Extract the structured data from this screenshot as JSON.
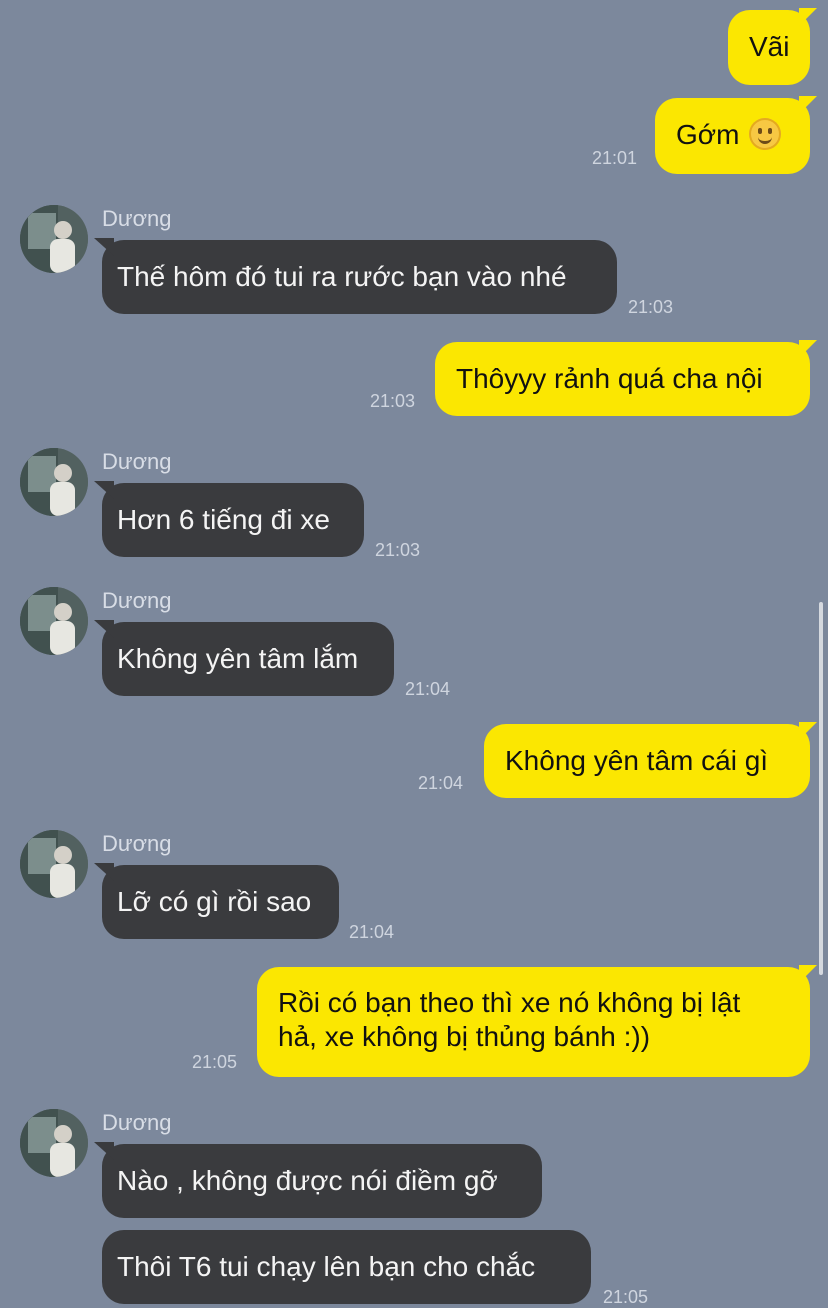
{
  "messages": [
    {
      "side": "sent",
      "text": "Vãi",
      "time": ""
    },
    {
      "side": "sent",
      "text": "Gớm",
      "time": "21:01"
    },
    {
      "side": "received",
      "name": "Dương",
      "text": "Thế hôm đó tui ra rước bạn vào nhé",
      "time": "21:03"
    },
    {
      "side": "sent",
      "text": "Thôyyy rảnh quá cha nội",
      "time": "21:03"
    },
    {
      "side": "received",
      "name": "Dương",
      "text": "Hơn 6 tiếng đi xe",
      "time": "21:03"
    },
    {
      "side": "received",
      "name": "Dương",
      "text": "Không yên tâm lắm",
      "time": "21:04"
    },
    {
      "side": "sent",
      "text": "Không yên tâm cái gì",
      "time": "21:04"
    },
    {
      "side": "received",
      "name": "Dương",
      "text": "Lỡ có gì rồi sao",
      "time": "21:04"
    },
    {
      "side": "sent",
      "text_lines": [
        "Rồi có bạn theo thì xe nó không bị lật",
        "hả, xe không bị thủng bánh :))"
      ],
      "time": "21:05"
    },
    {
      "side": "received",
      "name": "Dương",
      "text": "Nào , không được nói điềm gỡ",
      "time": ""
    },
    {
      "side": "received",
      "text": "Thôi T6 tui chạy lên bạn cho chắc",
      "time": "21:05"
    }
  ],
  "icons": {
    "smile_emoji": "smiling-face-emoji-icon"
  },
  "colors": {
    "background": "#7c889c",
    "sent_bubble": "#fbe701",
    "received_bubble": "#3a3b3e"
  }
}
